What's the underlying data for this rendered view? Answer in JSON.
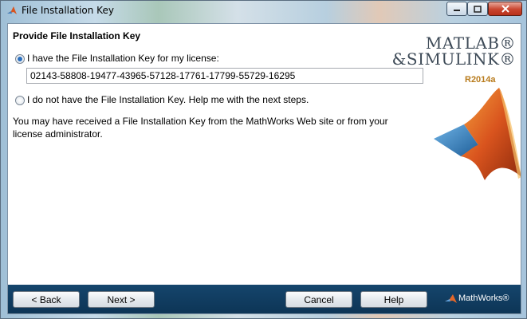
{
  "window": {
    "title": "File Installation Key",
    "controls": {
      "minimize_icon": "minimize-icon",
      "maximize_icon": "maximize-icon",
      "close_icon": "close-icon"
    }
  },
  "page": {
    "heading": "Provide File Installation Key",
    "option_have_key": {
      "label": "I have the File Installation Key for my license:",
      "selected": true
    },
    "key_input": {
      "value": "02143-58808-19477-43965-57128-17761-17799-55729-16295"
    },
    "option_no_key": {
      "label": "I do not have the File Installation Key.  Help me with the next steps.",
      "selected": false
    },
    "info_text": "You may have received a File Installation Key from the MathWorks Web site or from your license administrator."
  },
  "branding": {
    "product_line1": "MATLAB®",
    "product_line2": "&SIMULINK®",
    "release": "R2014a",
    "company": "MathWorks®"
  },
  "footer": {
    "back_label": "< Back",
    "next_label": "Next >",
    "cancel_label": "Cancel",
    "help_label": "Help"
  },
  "colors": {
    "footer_bg": "#15456c",
    "radio_dot": "#2a6fbf",
    "release_color": "#b87b1c",
    "close_button": "#c9442e"
  }
}
